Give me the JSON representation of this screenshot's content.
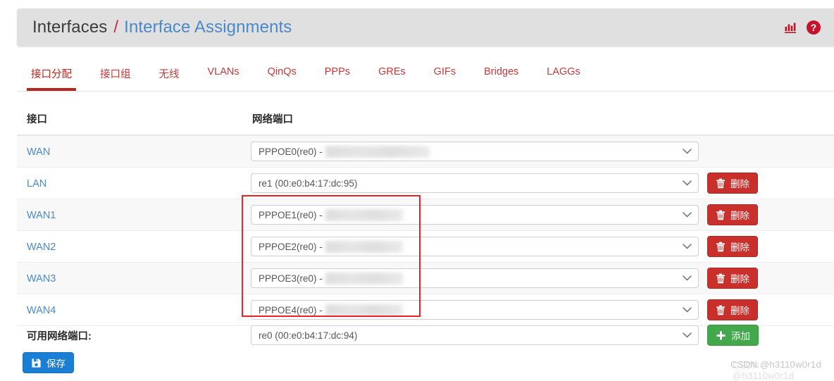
{
  "header": {
    "breadcrumb_root": "Interfaces",
    "breadcrumb_separator": "/",
    "breadcrumb_current": "Interface Assignments",
    "icons": [
      {
        "name": "stats-icon",
        "title": "Status Monitoring"
      },
      {
        "name": "help-icon",
        "title": "Help"
      }
    ],
    "icon_color": "#c4132a"
  },
  "tabs": [
    {
      "label": "接口分配",
      "active": true
    },
    {
      "label": "接口组",
      "active": false
    },
    {
      "label": "无线",
      "active": false
    },
    {
      "label": "VLANs",
      "active": false
    },
    {
      "label": "QinQs",
      "active": false
    },
    {
      "label": "PPPs",
      "active": false
    },
    {
      "label": "GREs",
      "active": false
    },
    {
      "label": "GIFs",
      "active": false
    },
    {
      "label": "Bridges",
      "active": false
    },
    {
      "label": "LAGGs",
      "active": false
    }
  ],
  "table": {
    "headers": {
      "interface": "接口",
      "network_port": "网络端口"
    },
    "rows": [
      {
        "interface": "WAN",
        "port_value": "PPPOE0(re0) -",
        "redacted": true,
        "redact_width": "wide",
        "has_delete": false
      },
      {
        "interface": "LAN",
        "port_value": "re1 (00:e0:b4:17:dc:95)",
        "redacted": false,
        "redact_width": "",
        "has_delete": true
      },
      {
        "interface": "WAN1",
        "port_value": "PPPOE1(re0) -",
        "redacted": true,
        "redact_width": "",
        "has_delete": true
      },
      {
        "interface": "WAN2",
        "port_value": "PPPOE2(re0) -",
        "redacted": true,
        "redact_width": "",
        "has_delete": true
      },
      {
        "interface": "WAN3",
        "port_value": "PPPOE3(re0) -",
        "redacted": true,
        "redact_width": "",
        "has_delete": true
      },
      {
        "interface": "WAN4",
        "port_value": "PPPOE4(re0) -",
        "redacted": true,
        "redact_width": "",
        "has_delete": true
      }
    ],
    "delete_label": "删除"
  },
  "footer": {
    "available_ports_label": "可用网络端口:",
    "available_ports_value": "re0 (00:e0:b4:17:dc:94)",
    "add_label": "添加",
    "save_label": "保存"
  },
  "annotation": {
    "highlight_color": "#e8232a"
  },
  "watermark": {
    "text": "CSDN @h3110w0r1d"
  },
  "colors": {
    "accent_red": "#b5281f",
    "link_blue": "#4a89c8",
    "danger": "#c9302c",
    "success": "#42a84b",
    "primary": "#1a7fd4"
  }
}
